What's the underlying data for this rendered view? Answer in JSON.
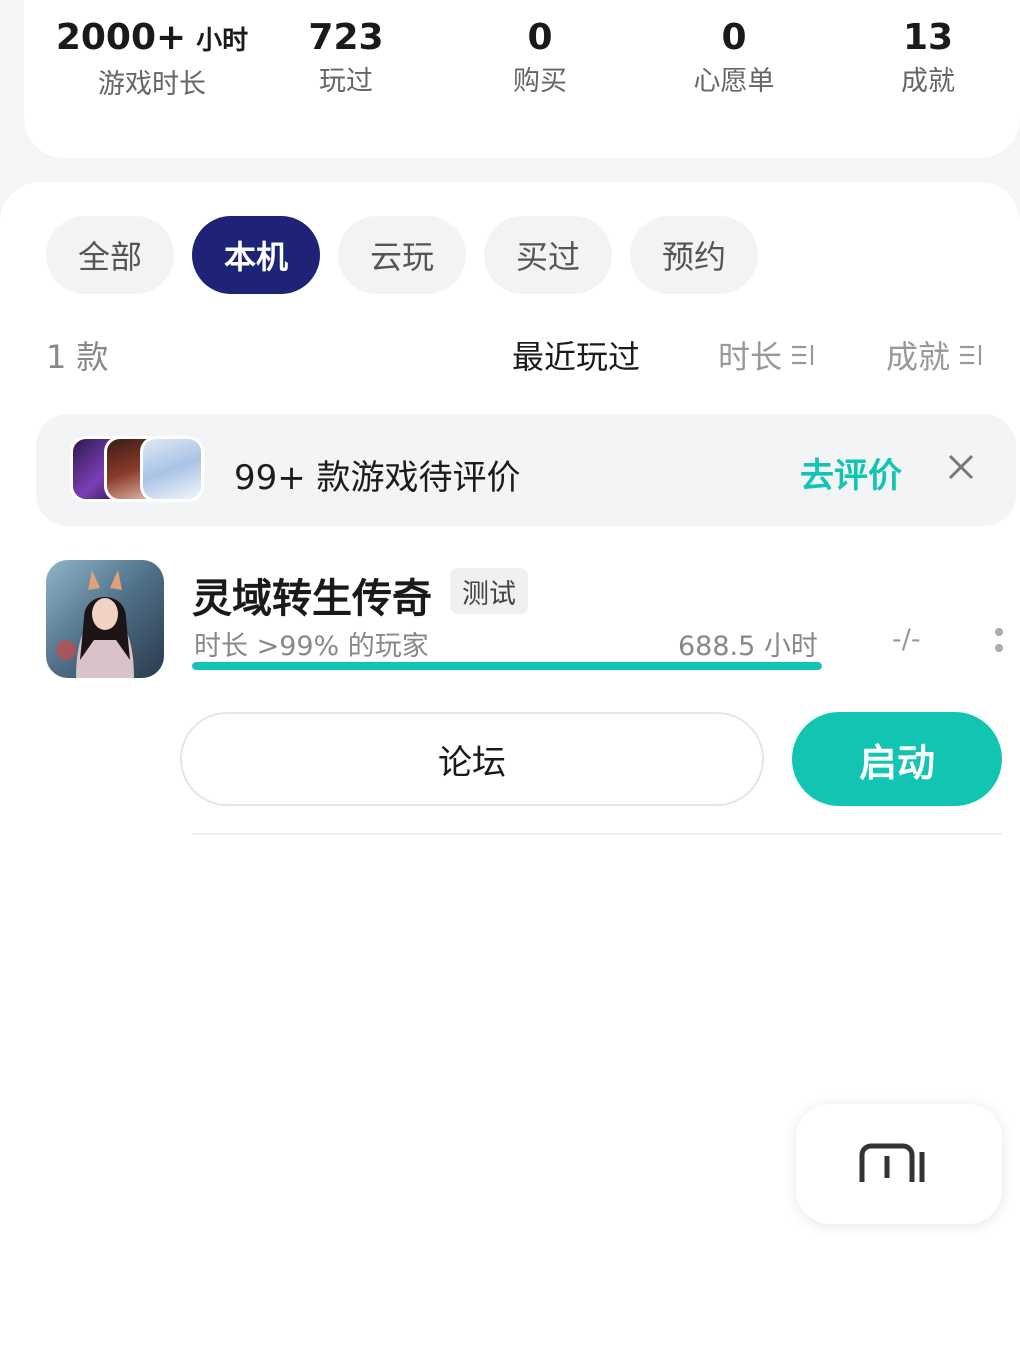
{
  "stats": [
    {
      "value": "2000+",
      "unit": "小时",
      "label": "游戏时长"
    },
    {
      "value": "723",
      "unit": "",
      "label": "玩过"
    },
    {
      "value": "0",
      "unit": "",
      "label": "购买"
    },
    {
      "value": "0",
      "unit": "",
      "label": "心愿单"
    },
    {
      "value": "13",
      "unit": "",
      "label": "成就"
    }
  ],
  "tabs": [
    {
      "label": "全部",
      "active": false
    },
    {
      "label": "本机",
      "active": true
    },
    {
      "label": "云玩",
      "active": false
    },
    {
      "label": "买过",
      "active": false
    },
    {
      "label": "预约",
      "active": false
    }
  ],
  "list": {
    "count": "1 款",
    "sort": [
      {
        "label": "最近玩过",
        "active": true
      },
      {
        "label": "时长",
        "active": false
      },
      {
        "label": "成就",
        "active": false
      }
    ]
  },
  "review_banner": {
    "text": "99+ 款游戏待评价",
    "action": "去评价"
  },
  "game": {
    "title": "灵域转生传奇",
    "tag": "测试",
    "playtime_rank": "时长 >99% 的玩家",
    "hours": "688.5 小时",
    "progress": 1.0,
    "achievements": "-/-",
    "forum_label": "论坛",
    "launch_label": "启动"
  },
  "colors": {
    "accent": "#12c5b3",
    "tab_active": "#1e2378"
  }
}
